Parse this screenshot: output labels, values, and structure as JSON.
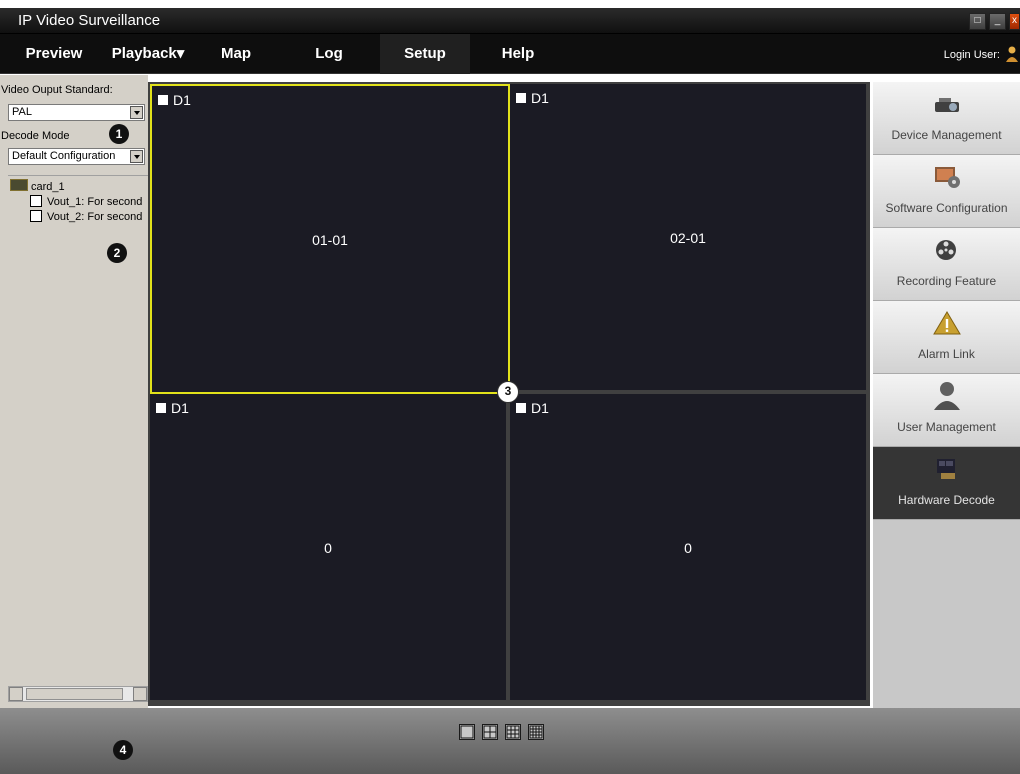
{
  "app": {
    "title": "IP Video Surveillance"
  },
  "menu": {
    "items": [
      {
        "label": "Preview"
      },
      {
        "label": "Playback▾"
      },
      {
        "label": "Map"
      },
      {
        "label": "Log"
      },
      {
        "label": "Setup"
      },
      {
        "label": "Help"
      }
    ],
    "login_user": "Login User:"
  },
  "left_panel": {
    "video_output_label": "Video Ouput Standard:",
    "video_output_value": "PAL",
    "decode_mode_label": "Decode Mode",
    "decode_mode_value": "Default Configuration",
    "tree": {
      "root": "card_1",
      "children": [
        "Vout_1: For second",
        "Vout_2: For second"
      ]
    }
  },
  "grid": {
    "cells": [
      {
        "stream": "D1",
        "label": "01-01",
        "selected": true
      },
      {
        "stream": "D1",
        "label": "02-01",
        "selected": false
      },
      {
        "stream": "D1",
        "label": "0",
        "selected": false
      },
      {
        "stream": "D1",
        "label": "0",
        "selected": false
      }
    ]
  },
  "right_panel": {
    "items": [
      {
        "label": "Device Management",
        "icon": "projector-icon"
      },
      {
        "label": "Software Configuration",
        "icon": "software-config-icon"
      },
      {
        "label": "Recording Feature",
        "icon": "film-reel-icon"
      },
      {
        "label": "Alarm Link",
        "icon": "warning-icon"
      },
      {
        "label": "User Management",
        "icon": "user-icon"
      },
      {
        "label": "Hardware Decode",
        "icon": "hardware-decode-icon"
      }
    ],
    "active": "Hardware Decode"
  },
  "bottom_bar": {
    "layouts": [
      "1x1",
      "2x2",
      "3x3",
      "4x4"
    ]
  },
  "callouts": [
    "1",
    "2",
    "3",
    "4"
  ],
  "colors": {
    "selected_border": "#e2e21a",
    "cell_bg": "#1b1b24",
    "menu_bg": "#0e0e0e"
  }
}
